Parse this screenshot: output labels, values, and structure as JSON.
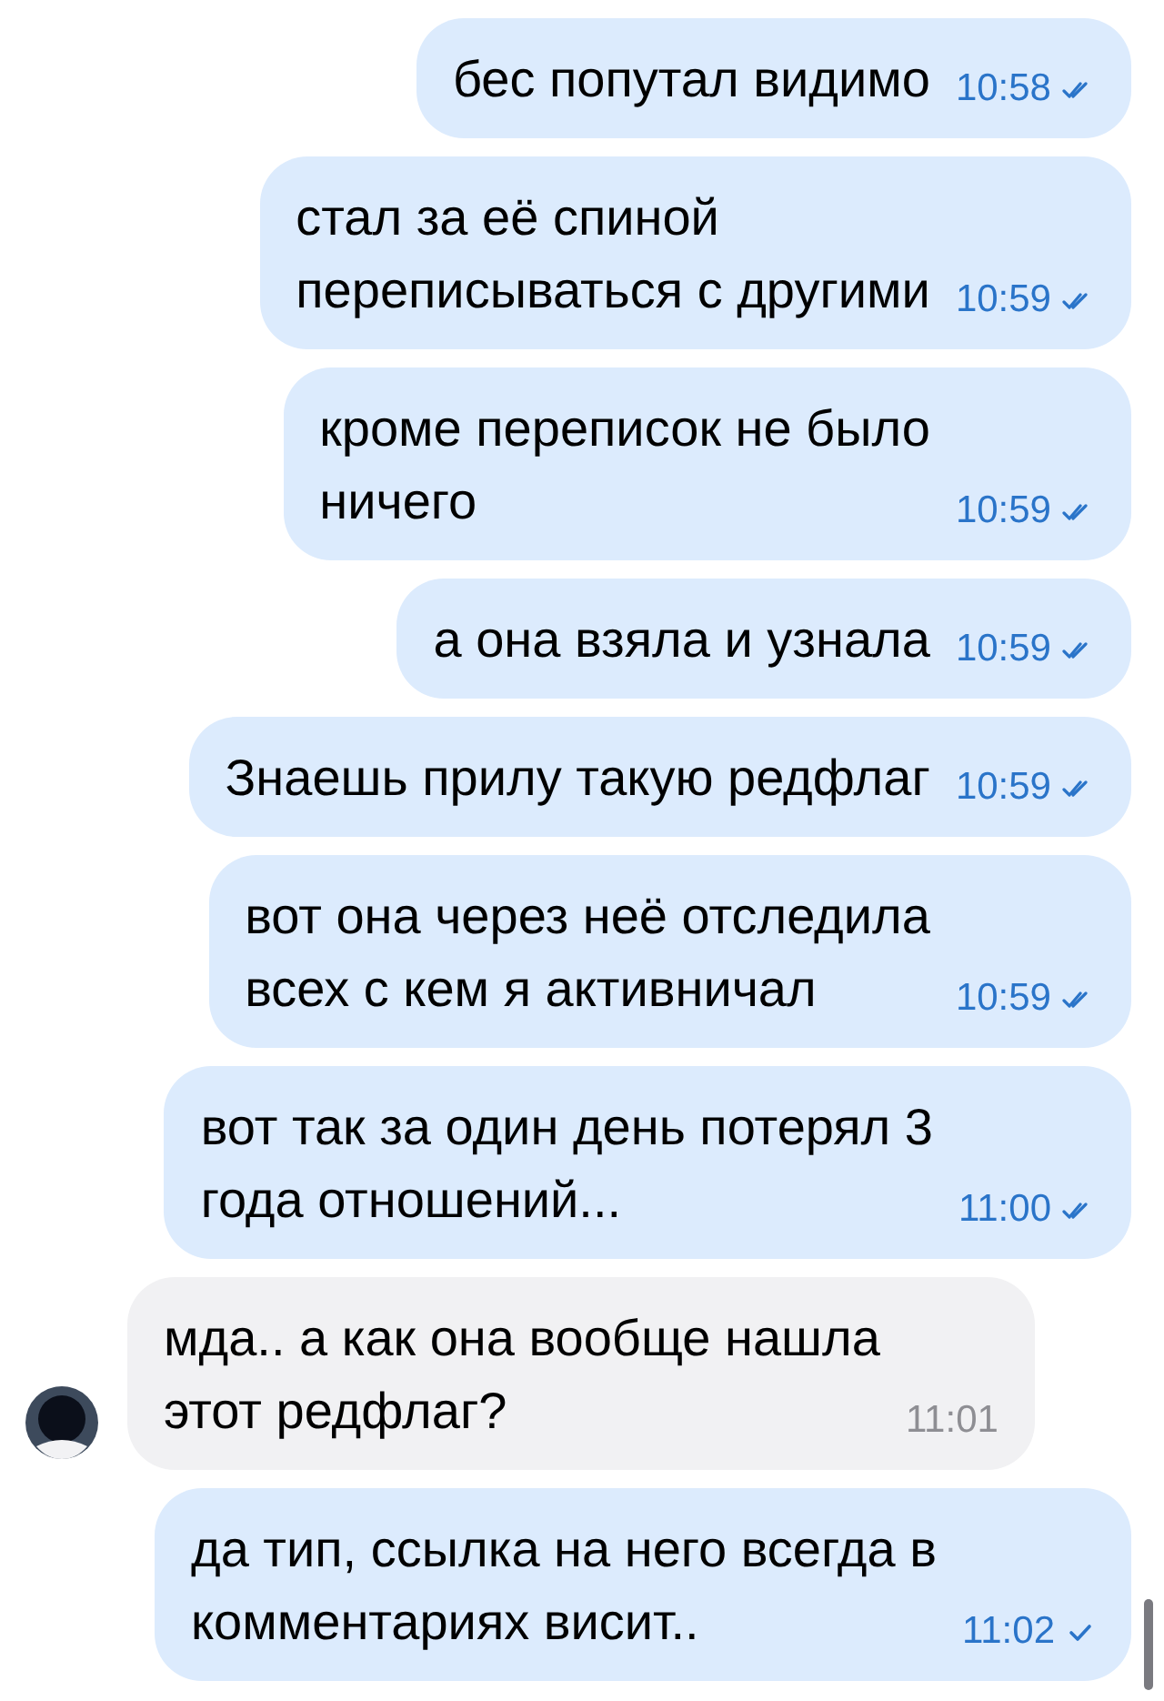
{
  "messages": [
    {
      "outgoing": true,
      "text": "бес попутал видимо",
      "time": "10:58",
      "read": true
    },
    {
      "outgoing": true,
      "text": "стал за её спиной\nпереписываться с другими",
      "time": "10:59",
      "read": true
    },
    {
      "outgoing": true,
      "text": "кроме переписок не было\nничего",
      "time": "10:59",
      "read": true
    },
    {
      "outgoing": true,
      "text": "а она взяла и узнала",
      "time": "10:59",
      "read": true
    },
    {
      "outgoing": true,
      "text": "Знаешь прилу такую редфлаг",
      "time": "10:59",
      "read": true
    },
    {
      "outgoing": true,
      "text": "вот она через неё отследила\nвсех с кем я активничал",
      "time": "10:59",
      "read": true
    },
    {
      "outgoing": true,
      "text": "вот так за один день потерял 3\nгода отношений...",
      "time": "11:00",
      "read": true
    },
    {
      "outgoing": false,
      "text": "мда.. а как она вообще нашла\nэтот редфлаг?",
      "time": "11:01"
    },
    {
      "outgoing": true,
      "text": "да тип, ссылка на него всегда в\nкомментариях висит..",
      "time": "11:02",
      "read": false
    }
  ]
}
